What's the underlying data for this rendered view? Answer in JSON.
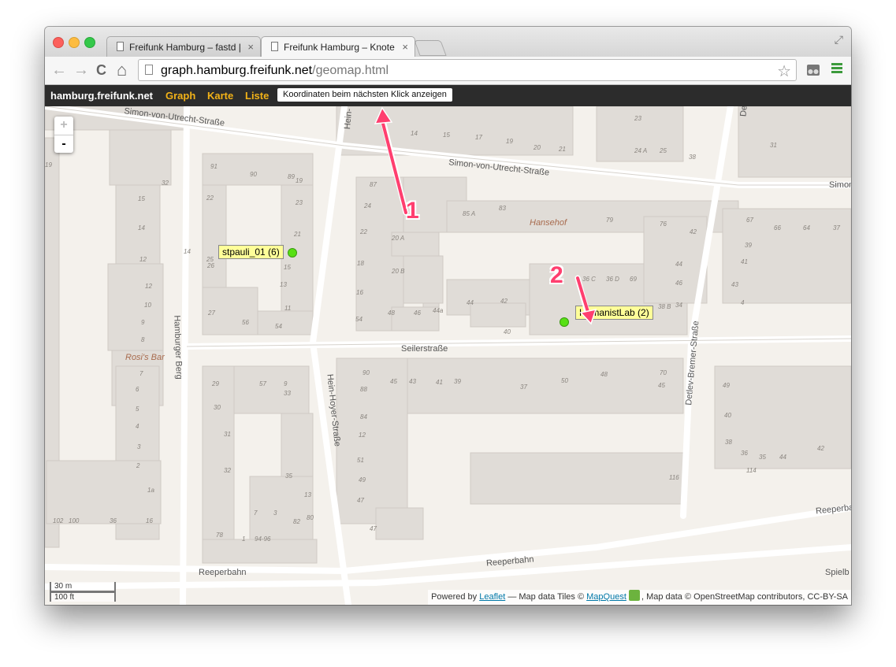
{
  "browser": {
    "tabs": [
      {
        "title": "Freifunk Hamburg – fastd |"
      },
      {
        "title": "Freifunk Hamburg – Knote"
      }
    ],
    "tab_close": "×",
    "url_host": "graph.hamburg.freifunk.net",
    "url_path": "/geomap.html",
    "nav_back": "←",
    "nav_forward": "→",
    "nav_reload": "C",
    "nav_home": "⌂",
    "bookmark": "☆",
    "fullscreen": "⤢"
  },
  "appbar": {
    "brand": "hamburg.freifunk.net",
    "links": [
      "Graph",
      "Karte",
      "Liste"
    ],
    "coord_button": "Koordinaten beim nächsten Klick anzeigen",
    "accent_color": "#f2b218"
  },
  "map": {
    "zoom_in": "+",
    "zoom_out": "-",
    "scale_metric": "30 m",
    "scale_imperial": "100 ft",
    "attribution": {
      "powered_by": "Powered by ",
      "leaflet": "Leaflet",
      "tiles": " — Map data Tiles © ",
      "mapquest": "MapQuest",
      "rest": ", Map data © OpenStreetMap contributors, CC-BY-SA"
    },
    "streets": {
      "simon_top": "Simon-von-Utrecht-Straße",
      "simon_mid": "Simon-von-Utrecht-Straße",
      "simon_right": "Simon",
      "hein_top": "Hein-",
      "hein_hoyer": "Hein-Hoyer-Straße",
      "hamburger_berg": "Hamburger Berg",
      "seiler": "Seilerstraße",
      "detlev": "Detlev-Bremer-Straße",
      "reeperbahn_left": "Reeperbahn",
      "reeperbahn_mid": "Reeperbahn",
      "reeperbahn_right": "Reeperba",
      "spielb": "Spielb",
      "de_top": "De"
    },
    "pois": {
      "hansehof": "Hansehof",
      "rosis_bar": "Rosi's Bar"
    },
    "house_numbers": [
      "91",
      "90",
      "89",
      "22",
      "23",
      "19",
      "21",
      "25",
      "26",
      "15",
      "13",
      "27",
      "11",
      "56",
      "54",
      "14",
      "15",
      "14",
      "12",
      "12",
      "10",
      "9",
      "8",
      "7",
      "6",
      "5",
      "4",
      "3",
      "2",
      "1a",
      "87",
      "24",
      "22",
      "20 A",
      "20 B",
      "18",
      "16",
      "54",
      "48",
      "46",
      "44a",
      "44",
      "42",
      "40",
      "85 A",
      "83",
      "79",
      "76",
      "42",
      "44",
      "46",
      "34",
      "38 B",
      "36 C",
      "36 D",
      "69",
      "67",
      "66",
      "64",
      "37",
      "39",
      "41",
      "43",
      "4",
      "23",
      "24 A",
      "25",
      "38",
      "14",
      "15",
      "17",
      "19",
      "20",
      "21",
      "31",
      "29",
      "57",
      "9",
      "30",
      "31",
      "32",
      "33",
      "35",
      "13",
      "7",
      "3",
      "82",
      "80",
      "78",
      "1",
      "94-96",
      "90",
      "88",
      "84",
      "12",
      "51",
      "49",
      "47",
      "45",
      "43",
      "41",
      "39",
      "37",
      "50",
      "48",
      "70",
      "45",
      "47",
      "49",
      "40",
      "38",
      "36",
      "35",
      "44",
      "42",
      "116",
      "114",
      "102",
      "100",
      "36",
      "16",
      "19",
      "32"
    ],
    "nodes": [
      {
        "label": "stpauli_01 (6)"
      },
      {
        "label": "HumanistLab (2)"
      }
    ],
    "node_color": "#58e014"
  },
  "annotations": {
    "callout_1": "1",
    "callout_2": "2",
    "arrow_color": "#ff3f6f"
  }
}
